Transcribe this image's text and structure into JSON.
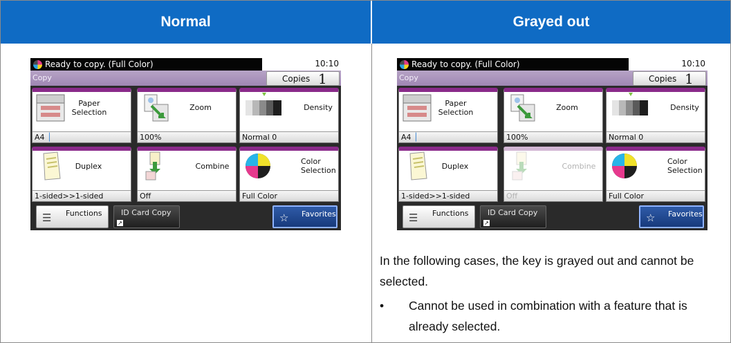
{
  "headers": {
    "normal": "Normal",
    "grayed": "Grayed out"
  },
  "panel": {
    "status": "Ready to copy. (Full Color)",
    "time": "10:10",
    "mode": "Copy",
    "copies_label": "Copies",
    "copies_value": "1",
    "keys": {
      "paper": {
        "line1": "Paper",
        "line2": "Selection",
        "value": "A4"
      },
      "zoom": {
        "label": "Zoom",
        "value": "100%"
      },
      "density": {
        "label": "Density",
        "value": "Normal 0"
      },
      "duplex": {
        "label": "Duplex",
        "value": "1-sided>>1-sided"
      },
      "combine": {
        "label": "Combine",
        "value": "Off"
      },
      "color": {
        "line1": "Color",
        "line2": "Selection",
        "value": "Full Color"
      }
    },
    "bottom": {
      "functions": "Functions",
      "id_card": "ID Card Copy",
      "favorites": "Favorites"
    }
  },
  "note": {
    "text": "In the following cases, the key is grayed out and cannot be selected.",
    "bullet_symbol": "•",
    "bullet": "Cannot be used in combination with a feature that is already selected."
  },
  "colors": {
    "header_bg": "#0f6bc4",
    "key_accent": "#8a2a8a",
    "favorites_bg": "#2f5ba8"
  }
}
